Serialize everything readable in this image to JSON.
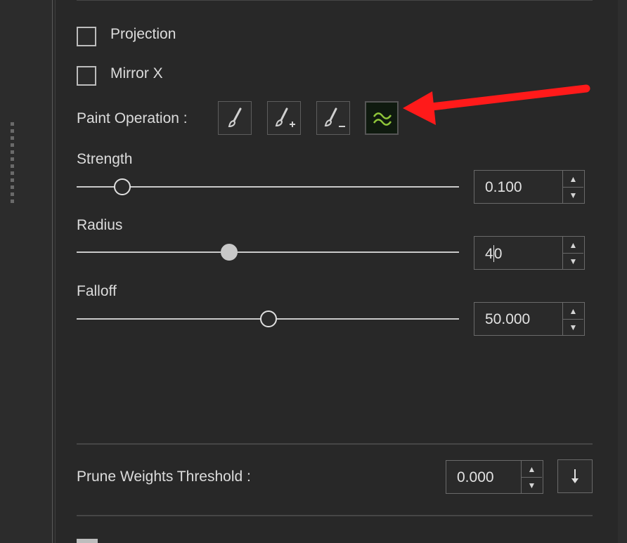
{
  "projection": {
    "label": "Projection",
    "checked": false
  },
  "mirror_x": {
    "label": "Mirror X",
    "checked": false
  },
  "paint_operation": {
    "label": "Paint Operation :",
    "buttons": [
      {
        "icon": "brush-icon",
        "active": false
      },
      {
        "icon": "brush-add-icon",
        "active": false
      },
      {
        "icon": "brush-subtract-icon",
        "active": false
      },
      {
        "icon": "smooth-icon",
        "active": true
      }
    ],
    "colors": {
      "icon": "#d0d0d0",
      "active_icon": "#8fc63a",
      "annotation_arrow": "#ff1a1a"
    }
  },
  "strength": {
    "label": "Strength",
    "value": "0.100",
    "level": 0.12
  },
  "radius": {
    "label": "Radius",
    "value_before_caret": "4",
    "value_after_caret": "0",
    "level": 0.4
  },
  "falloff": {
    "label": "Falloff",
    "value": "50.000",
    "level": 0.5
  },
  "prune": {
    "label": "Prune Weights Threshold :",
    "value": "0.000"
  }
}
